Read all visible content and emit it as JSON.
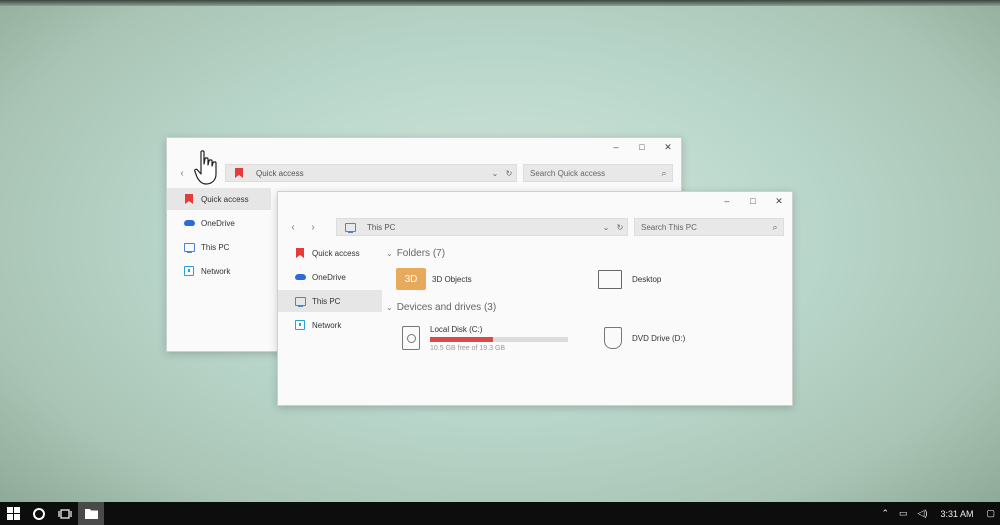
{
  "back_window": {
    "controls": {
      "minimize": "–",
      "maximize": "□",
      "close": "✕"
    },
    "address": "Quick access",
    "search_placeholder": "Search Quick access",
    "sidebar": [
      {
        "label": "Quick access",
        "icon": "bookmark-icon",
        "selected": true
      },
      {
        "label": "OneDrive",
        "icon": "cloud-icon"
      },
      {
        "label": "This PC",
        "icon": "monitor-icon"
      },
      {
        "label": "Network",
        "icon": "network-icon"
      }
    ]
  },
  "front_window": {
    "controls": {
      "minimize": "–",
      "maximize": "□",
      "close": "✕"
    },
    "address": "This PC",
    "search_placeholder": "Search This PC",
    "sidebar": [
      {
        "label": "Quick access",
        "icon": "bookmark-icon"
      },
      {
        "label": "OneDrive",
        "icon": "cloud-icon"
      },
      {
        "label": "This PC",
        "icon": "monitor-icon",
        "selected": true
      },
      {
        "label": "Network",
        "icon": "network-icon"
      }
    ],
    "folders_heading": "Folders (7)",
    "folders": [
      {
        "label": "3D Objects",
        "icon_text": "3D"
      },
      {
        "label": "Desktop"
      }
    ],
    "devices_heading": "Devices and drives (3)",
    "drives": [
      {
        "label": "Local Disk (C:)",
        "detail": "10.5 GB free of 19.3 GB",
        "used_fraction": 0.46
      },
      {
        "label": "DVD Drive (D:)"
      }
    ]
  },
  "taskbar": {
    "clock": "3:31 AM"
  },
  "colors": {
    "accent_red": "#d94a4a",
    "folder_orange": "#e7a95c",
    "taskbar": "#0d0d0d"
  }
}
